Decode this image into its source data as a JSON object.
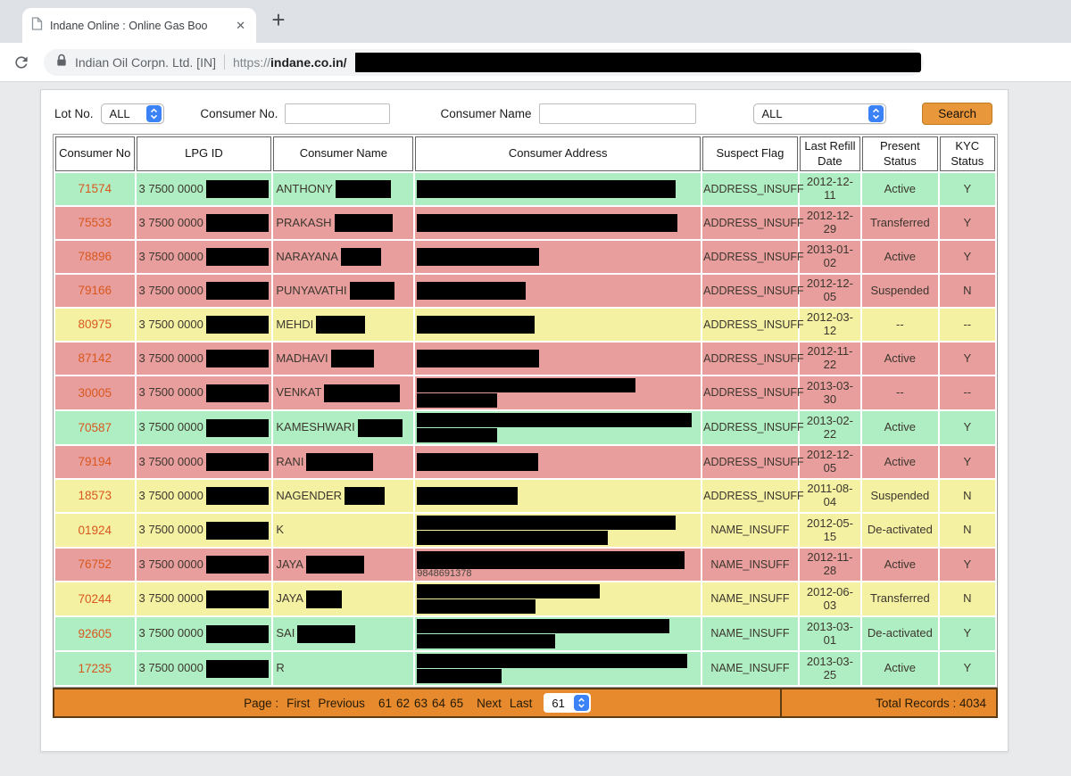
{
  "colors": {
    "green": "#aeeec2",
    "red": "#e89e9d",
    "yellow": "#f4f1a3",
    "footer_orange": "#e78a2e",
    "search_orange": "#e9973b",
    "consumer_no_text": "#d9571e"
  },
  "browser": {
    "tab_title": "Indane Online : Online Gas Boo",
    "close_glyph": "✕",
    "new_tab_glyph": "+",
    "site_identity": "Indian Oil Corpn. Ltd. [IN]",
    "url_scheme": "https://",
    "url_domain": "indane",
    "url_rest": ".co.in/"
  },
  "filters": {
    "lot_label": "Lot No.",
    "lot_value": "ALL",
    "consumer_no_label": "Consumer No.",
    "consumer_no_value": "",
    "consumer_name_label": "Consumer Name",
    "consumer_name_value": "",
    "status_value": "ALL",
    "search_label": "Search"
  },
  "table": {
    "headers": [
      "Consumer No",
      "LPG ID",
      "Consumer Name",
      "Consumer Address",
      "Suspect Flag",
      "Last Refill Date",
      "Present Status",
      "KYC Status"
    ],
    "lpg_prefix": "3 7500 0000",
    "rows": [
      {
        "no": "71574",
        "color": "green",
        "name": "ANTHONY",
        "name_redact": 62,
        "addr_bars": [
          290
        ],
        "suspect": "ADDRESS_INSUFF",
        "date": "2012-12-11",
        "status": "Active",
        "kyc": "Y"
      },
      {
        "no": "75533",
        "color": "red",
        "name": "PRAKASH",
        "name_redact": 65,
        "addr_bars": [
          292
        ],
        "suspect": "ADDRESS_INSUFF",
        "date": "2012-12-29",
        "status": "Transferred",
        "kyc": "Y"
      },
      {
        "no": "78896",
        "color": "red",
        "name": "NARAYANA",
        "name_redact": 45,
        "addr_bars": [
          137
        ],
        "suspect": "ADDRESS_INSUFF",
        "date": "2013-01-02",
        "status": "Active",
        "kyc": "Y"
      },
      {
        "no": "79166",
        "color": "red",
        "name": "PUNYAVATHI",
        "name_redact": 50,
        "addr_bars": [
          122
        ],
        "suspect": "ADDRESS_INSUFF",
        "date": "2012-12-05",
        "status": "Suspended",
        "kyc": "N"
      },
      {
        "no": "80975",
        "color": "yellow",
        "name": "MEHDI",
        "name_redact": 55,
        "addr_bars": [
          132
        ],
        "suspect": "ADDRESS_INSUFF",
        "date": "2012-03-12",
        "status": "--",
        "kyc": "--"
      },
      {
        "no": "87142",
        "color": "red",
        "name": "MADHAVI",
        "name_redact": 48,
        "addr_bars": [
          137
        ],
        "suspect": "ADDRESS_INSUFF",
        "date": "2012-11-22",
        "status": "Active",
        "kyc": "Y"
      },
      {
        "no": "30005",
        "color": "red",
        "name": "VENKAT",
        "name_redact": 85,
        "addr_bars": [
          245,
          90
        ],
        "suspect": "ADDRESS_INSUFF",
        "date": "2013-03-30",
        "status": "--",
        "kyc": "--"
      },
      {
        "no": "70587",
        "color": "green",
        "name": "KAMESHWARI",
        "name_redact": 50,
        "addr_bars": [
          308,
          90
        ],
        "suspect": "ADDRESS_INSUFF",
        "date": "2013-02-22",
        "status": "Active",
        "kyc": "Y"
      },
      {
        "no": "79194",
        "color": "red",
        "name": "RANI",
        "name_redact": 75,
        "addr_bars": [
          136
        ],
        "suspect": "ADDRESS_INSUFF",
        "date": "2012-12-05",
        "status": "Active",
        "kyc": "Y"
      },
      {
        "no": "18573",
        "color": "yellow",
        "name": "NAGENDER",
        "name_redact": 45,
        "addr_bars": [
          113
        ],
        "suspect": "ADDRESS_INSUFF",
        "date": "2011-08-04",
        "status": "Suspended",
        "kyc": "N"
      },
      {
        "no": "01924",
        "color": "yellow",
        "name": "K",
        "name_redact": 0,
        "addr_bars": [
          290,
          214
        ],
        "suspect": "NAME_INSUFF",
        "date": "2012-05-15",
        "status": "De-activated",
        "kyc": "N"
      },
      {
        "no": "76752",
        "color": "red",
        "name": "JAYA",
        "name_redact": 65,
        "addr_bars": [
          300
        ],
        "addr_text": "9848691378",
        "suspect": "NAME_INSUFF",
        "date": "2012-11-28",
        "status": "Active",
        "kyc": "Y"
      },
      {
        "no": "70244",
        "color": "yellow",
        "name": "JAYA",
        "name_redact": 40,
        "addr_bars": [
          205,
          133
        ],
        "suspect": "NAME_INSUFF",
        "date": "2012-06-03",
        "status": "Transferred",
        "kyc": "N"
      },
      {
        "no": "92605",
        "color": "green",
        "name": "SAI",
        "name_redact": 65,
        "addr_bars": [
          283,
          155
        ],
        "suspect": "NAME_INSUFF",
        "date": "2013-03-01",
        "status": "De-activated",
        "kyc": "Y"
      },
      {
        "no": "17235",
        "color": "green",
        "name": "R",
        "name_redact": 0,
        "addr_bars": [
          303,
          95
        ],
        "suspect": "NAME_INSUFF",
        "date": "2013-03-25",
        "status": "Active",
        "kyc": "Y"
      }
    ]
  },
  "footer": {
    "page_prefix": "Page :",
    "first": "First",
    "previous": "Previous",
    "pages": [
      "61",
      "62",
      "63",
      "64",
      "65"
    ],
    "next": "Next",
    "last": "Last",
    "page_select": "61",
    "total_records": "Total Records : 4034"
  }
}
